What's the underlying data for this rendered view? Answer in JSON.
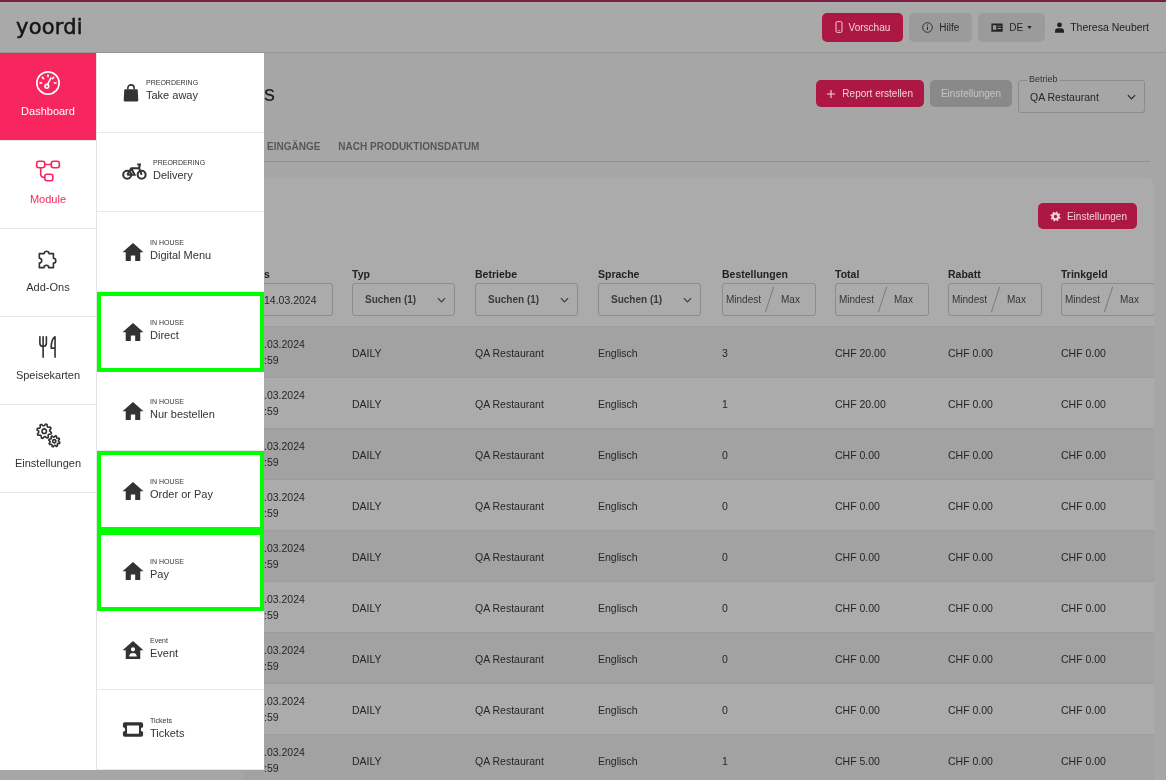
{
  "topbar": {
    "logo": "yoordi",
    "buttons": [
      {
        "label": "Vorschau",
        "kind": "preview"
      },
      {
        "label": "Hilfe",
        "kind": "help"
      },
      {
        "label": "DE",
        "kind": "language"
      }
    ],
    "user": "Theresa Neubert"
  },
  "sidebar": {
    "items": [
      {
        "label": "Dashboard",
        "selected": true,
        "expanded": false
      },
      {
        "label": "Module",
        "selected": false,
        "expanded": true
      },
      {
        "label": "Add-Ons",
        "selected": false,
        "expanded": false
      },
      {
        "label": "Speisekarten",
        "selected": false,
        "expanded": false
      },
      {
        "label": "Einstellungen",
        "selected": false,
        "expanded": false
      }
    ]
  },
  "module_menu": {
    "items": [
      {
        "category": "PREORDERING",
        "label": "Take away",
        "highlighted": false
      },
      {
        "category": "PREORDERING",
        "label": "Delivery",
        "highlighted": false
      },
      {
        "category": "IN HOUSE",
        "label": "Digital Menu",
        "highlighted": false
      },
      {
        "category": "IN HOUSE",
        "label": "Direct",
        "highlighted": true
      },
      {
        "category": "IN HOUSE",
        "label": "Nur bestellen",
        "highlighted": false
      },
      {
        "category": "IN HOUSE",
        "label": "Order or Pay",
        "highlighted": true
      },
      {
        "category": "IN HOUSE",
        "label": "Pay",
        "highlighted": true
      },
      {
        "category": "Event",
        "label": "Event",
        "highlighted": false
      },
      {
        "category": "Tickets",
        "label": "Tickets",
        "highlighted": false
      }
    ]
  },
  "page": {
    "title": "s",
    "actions": [
      {
        "label": "Report erstellen",
        "kind": "create",
        "disabled": false
      },
      {
        "label": "Einstellungen",
        "kind": "settings",
        "disabled": true
      }
    ],
    "select": {
      "label": "Betrieb",
      "value": "QA Restaurant"
    },
    "tabs": [
      {
        "label": "EINGÄNGE",
        "selected": false
      },
      {
        "label": "NACH PRODUKTIONSDATUM",
        "selected": false
      }
    ]
  },
  "report": {
    "settings_button": "Einstellungen",
    "table": {
      "columns": [
        {
          "label": "s",
          "filter": {
            "kind": "date",
            "value": "14.03.2024"
          }
        },
        {
          "label": "Typ",
          "filter": {
            "kind": "select",
            "value": "Suchen (1)"
          }
        },
        {
          "label": "Betriebe",
          "filter": {
            "kind": "select",
            "value": "Suchen (1)"
          }
        },
        {
          "label": "Sprache",
          "filter": {
            "kind": "select",
            "value": "Suchen (1)"
          }
        },
        {
          "label": "Bestellungen",
          "filter": {
            "kind": "range",
            "fields": [
              {
                "placeholder": "Mindest"
              },
              {
                "placeholder": "Max"
              }
            ]
          }
        },
        {
          "label": "Total",
          "filter": {
            "kind": "range",
            "fields": [
              {
                "placeholder": "Mindest"
              },
              {
                "placeholder": "Max"
              }
            ]
          }
        },
        {
          "label": "Rabatt",
          "filter": {
            "kind": "range",
            "fields": [
              {
                "placeholder": "Mindest"
              },
              {
                "placeholder": "Max"
              }
            ]
          }
        },
        {
          "label": "Trinkgeld",
          "filter": {
            "kind": "range",
            "fields": [
              {
                "placeholder": "Mindest"
              },
              {
                "placeholder": "Max"
              }
            ]
          }
        }
      ],
      "rows": [
        {
          "cells": [
            [
              ".03.2024",
              ":59"
            ],
            [
              "DAILY"
            ],
            [
              "QA Restaurant"
            ],
            [
              "Englisch"
            ],
            [
              "3"
            ],
            [
              "CHF 20.00"
            ],
            [
              "CHF 0.00"
            ],
            [
              "CHF 0.00"
            ]
          ]
        },
        {
          "cells": [
            [
              ".03.2024",
              ":59"
            ],
            [
              "DAILY"
            ],
            [
              "QA Restaurant"
            ],
            [
              "Englisch"
            ],
            [
              "1"
            ],
            [
              "CHF 20.00"
            ],
            [
              "CHF 0.00"
            ],
            [
              "CHF 0.00"
            ]
          ]
        },
        {
          "cells": [
            [
              ".03.2024",
              ":59"
            ],
            [
              "DAILY"
            ],
            [
              "QA Restaurant"
            ],
            [
              "Englisch"
            ],
            [
              "0"
            ],
            [
              "CHF 0.00"
            ],
            [
              "CHF 0.00"
            ],
            [
              "CHF 0.00"
            ]
          ]
        },
        {
          "cells": [
            [
              ".03.2024",
              ":59"
            ],
            [
              "DAILY"
            ],
            [
              "QA Restaurant"
            ],
            [
              "Englisch"
            ],
            [
              "0"
            ],
            [
              "CHF 0.00"
            ],
            [
              "CHF 0.00"
            ],
            [
              "CHF 0.00"
            ]
          ]
        },
        {
          "cells": [
            [
              ".03.2024",
              ":59"
            ],
            [
              "DAILY"
            ],
            [
              "QA Restaurant"
            ],
            [
              "Englisch"
            ],
            [
              "0"
            ],
            [
              "CHF 0.00"
            ],
            [
              "CHF 0.00"
            ],
            [
              "CHF 0.00"
            ]
          ]
        },
        {
          "cells": [
            [
              ".03.2024",
              ":59"
            ],
            [
              "DAILY"
            ],
            [
              "QA Restaurant"
            ],
            [
              "Englisch"
            ],
            [
              "0"
            ],
            [
              "CHF 0.00"
            ],
            [
              "CHF 0.00"
            ],
            [
              "CHF 0.00"
            ]
          ]
        },
        {
          "cells": [
            [
              ".03.2024",
              ":59"
            ],
            [
              "DAILY"
            ],
            [
              "QA Restaurant"
            ],
            [
              "Englisch"
            ],
            [
              "0"
            ],
            [
              "CHF 0.00"
            ],
            [
              "CHF 0.00"
            ],
            [
              "CHF 0.00"
            ]
          ]
        },
        {
          "cells": [
            [
              ".03.2024",
              ":59"
            ],
            [
              "DAILY"
            ],
            [
              "QA Restaurant"
            ],
            [
              "Englisch"
            ],
            [
              "0"
            ],
            [
              "CHF 0.00"
            ],
            [
              "CHF 0.00"
            ],
            [
              "CHF 0.00"
            ]
          ]
        },
        {
          "cells": [
            [
              ".03.2024",
              ":59"
            ],
            [
              "DAILY"
            ],
            [
              "QA Restaurant"
            ],
            [
              "Englisch"
            ],
            [
              "1"
            ],
            [
              "CHF 5.00"
            ],
            [
              "CHF 0.00"
            ],
            [
              "CHF 0.00"
            ]
          ]
        }
      ]
    }
  }
}
